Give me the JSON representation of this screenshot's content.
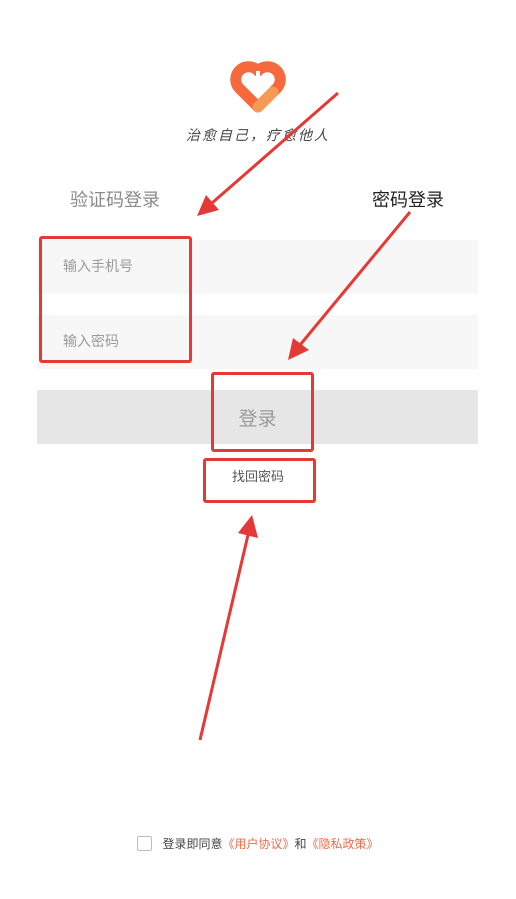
{
  "header": {
    "slogan": "治愈自己，疗愈他人",
    "brand_color": "#f5693d"
  },
  "tabs": {
    "sms_login": "验证码登录",
    "password_login": "密码登录",
    "active": "password_login"
  },
  "form": {
    "phone_placeholder": "输入手机号",
    "password_placeholder": "输入密码",
    "phone_value": "",
    "password_value": "",
    "login_button": "登录",
    "forgot_password": "找回密码"
  },
  "agreement": {
    "checked": false,
    "prefix": "登录即同意",
    "user_agreement": "《用户协议》",
    "conjunction": "和",
    "privacy_policy": "《隐私政策》",
    "link_color": "#f26b4b"
  },
  "annotations": {
    "highlight_color": "#e53935",
    "icon": "red-arrow-icon"
  }
}
